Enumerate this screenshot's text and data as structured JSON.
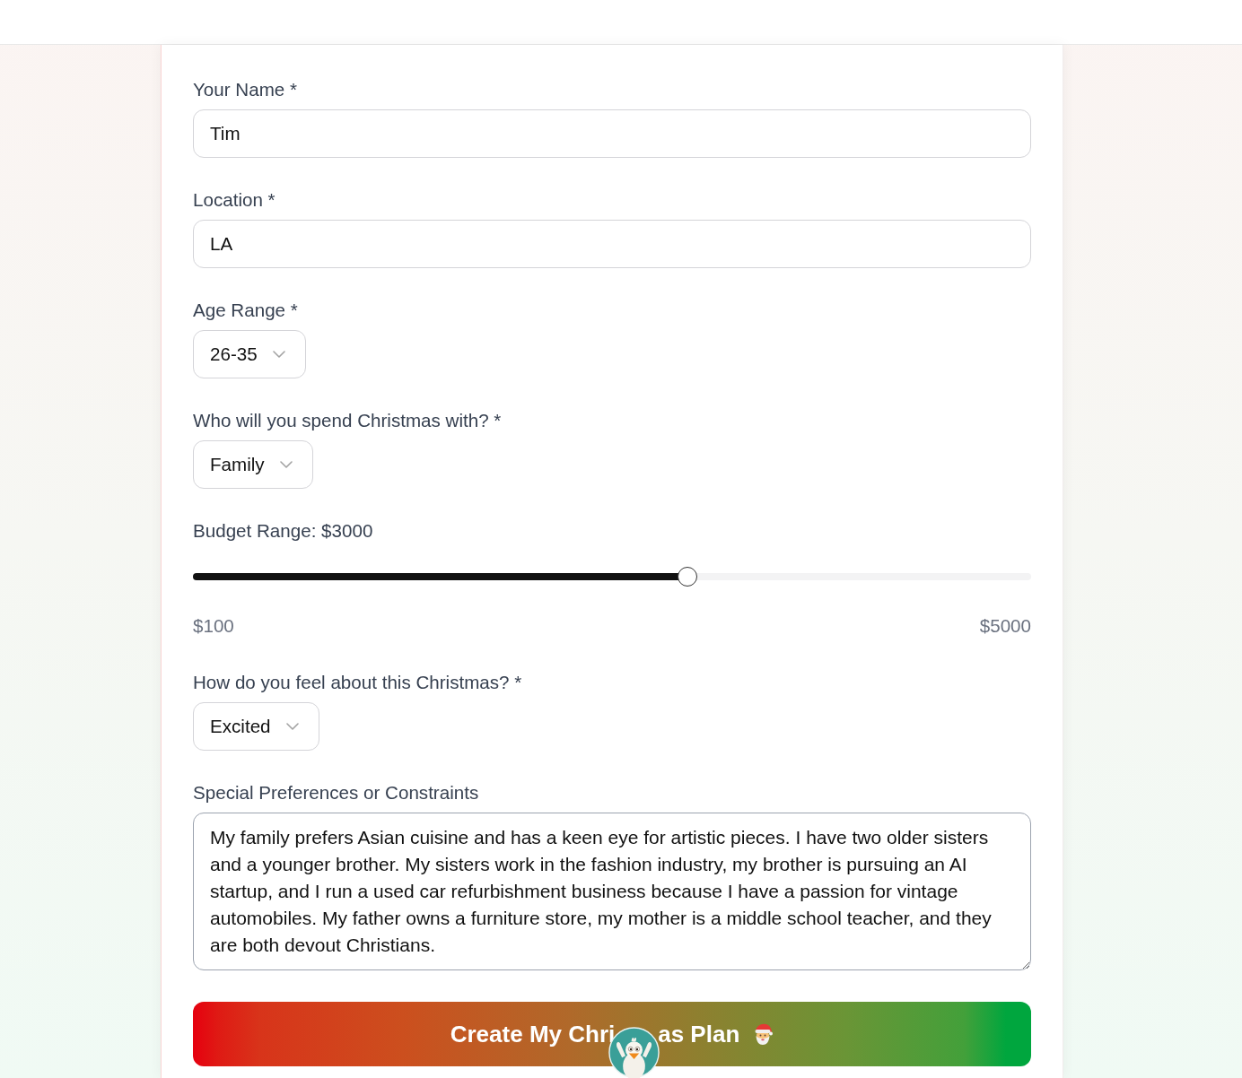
{
  "form": {
    "fields": [
      {
        "kind": "text",
        "label": "Your Name *",
        "value": "Tim"
      },
      {
        "kind": "text",
        "label": "Location *",
        "value": "LA"
      },
      {
        "kind": "select",
        "label": "Age Range *",
        "value": "26-35"
      },
      {
        "kind": "select",
        "label": "Who will you spend Christmas with? *",
        "value": "Family"
      },
      {
        "kind": "slider",
        "label": "Budget Range: $3000",
        "level": 0.59,
        "min_label": "$100",
        "max_label": "$5000"
      },
      {
        "kind": "select",
        "label": "How do you feel about this Christmas? *",
        "value": "Excited"
      },
      {
        "kind": "textarea",
        "label": "Special Preferences or Constraints",
        "value": "My family prefers Asian cuisine and has a keen eye for artistic pieces. I have two older sisters and a younger brother. My sisters work in the fashion industry, my brother is pursuing an AI startup, and I run a used car refurbishment business because I have a passion for vintage automobiles. My father owns a furniture store, my mother is a middle school teacher, and they are both devout Christians."
      }
    ],
    "submit_button": {
      "label_start": "Create My Chri",
      "label_end": "as Plan"
    }
  }
}
